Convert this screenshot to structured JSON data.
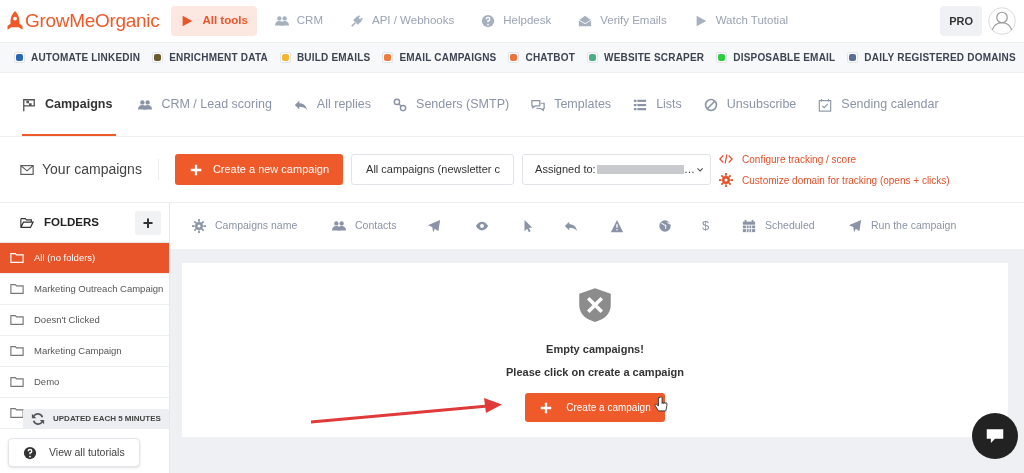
{
  "brand": {
    "name": "GrowMeOrganic"
  },
  "top_nav": [
    {
      "label": "All tools",
      "selected": true
    },
    {
      "label": "CRM",
      "selected": false
    },
    {
      "label": "API / Webhooks",
      "selected": false
    },
    {
      "label": "Helpdesk",
      "selected": false
    },
    {
      "label": "Verify Emails",
      "selected": false
    },
    {
      "label": "Watch Tutotial",
      "selected": false
    }
  ],
  "plan_badge": "PRO",
  "tools": [
    {
      "label": "AUTOMATE LINKEDIN",
      "color": "#2867b2"
    },
    {
      "label": "ENRICHMENT DATA",
      "color": "#6b5a2e"
    },
    {
      "label": "BUILD EMAILS",
      "color": "#f2b632"
    },
    {
      "label": "EMAIL CAMPAIGNS",
      "color": "#f07b3f"
    },
    {
      "label": "CHATBOT",
      "color": "#e8743b"
    },
    {
      "label": "WEBSITE SCRAPER",
      "color": "#4caf83"
    },
    {
      "label": "DISPOSABLE EMAIL",
      "color": "#2ecc40"
    },
    {
      "label": "DAILY REGISTERED DOMAINS",
      "color": "#5b6e9a"
    }
  ],
  "tabs": [
    {
      "label": "Campaigns",
      "selected": true
    },
    {
      "label": "CRM / Lead scoring",
      "selected": false
    },
    {
      "label": "All replies",
      "selected": false
    },
    {
      "label": "Senders (SMTP)",
      "selected": false
    },
    {
      "label": "Templates",
      "selected": false
    },
    {
      "label": "Lists",
      "selected": false
    },
    {
      "label": "Unsubscribe",
      "selected": false
    },
    {
      "label": "Sending calendar",
      "selected": false
    }
  ],
  "toolbar": {
    "title": "Your campaigns",
    "create_button": "Create a new campaign",
    "filter_select": "All campaigns (newsletter c",
    "assigned_select": {
      "label": "Assigned to:",
      "suffix": "…"
    },
    "links": [
      "Configure tracking / score",
      "Customize domain for tracking (opens + clicks)"
    ]
  },
  "folders": {
    "title": "FOLDERS",
    "add_button": "+",
    "items": [
      {
        "label": "All (no folders)",
        "selected": true
      },
      {
        "label": "Marketing Outreach Campaign",
        "selected": false
      },
      {
        "label": "Doesn't Clicked",
        "selected": false
      },
      {
        "label": "Marketing Campaign",
        "selected": false
      },
      {
        "label": "Demo",
        "selected": false
      },
      {
        "selected": false
      }
    ]
  },
  "columns": [
    {
      "kind": "labeled",
      "label": "Campaigns name"
    },
    {
      "kind": "labeled",
      "label": "Contacts"
    },
    {
      "kind": "icon"
    },
    {
      "kind": "icon"
    },
    {
      "kind": "icon"
    },
    {
      "kind": "icon"
    },
    {
      "kind": "icon"
    },
    {
      "kind": "icon"
    },
    {
      "kind": "text",
      "label": "$"
    },
    {
      "kind": "labeled",
      "label": "Scheduled"
    },
    {
      "kind": "labeled",
      "label": "Run the campaign"
    }
  ],
  "empty_state": {
    "title": "Empty campaigns!",
    "message": "Please click on create a campaign",
    "button": "Create a campaign"
  },
  "update_badge": "UPDATED EACH 5 MINUTES",
  "tutorials_button": "View all tutorials"
}
